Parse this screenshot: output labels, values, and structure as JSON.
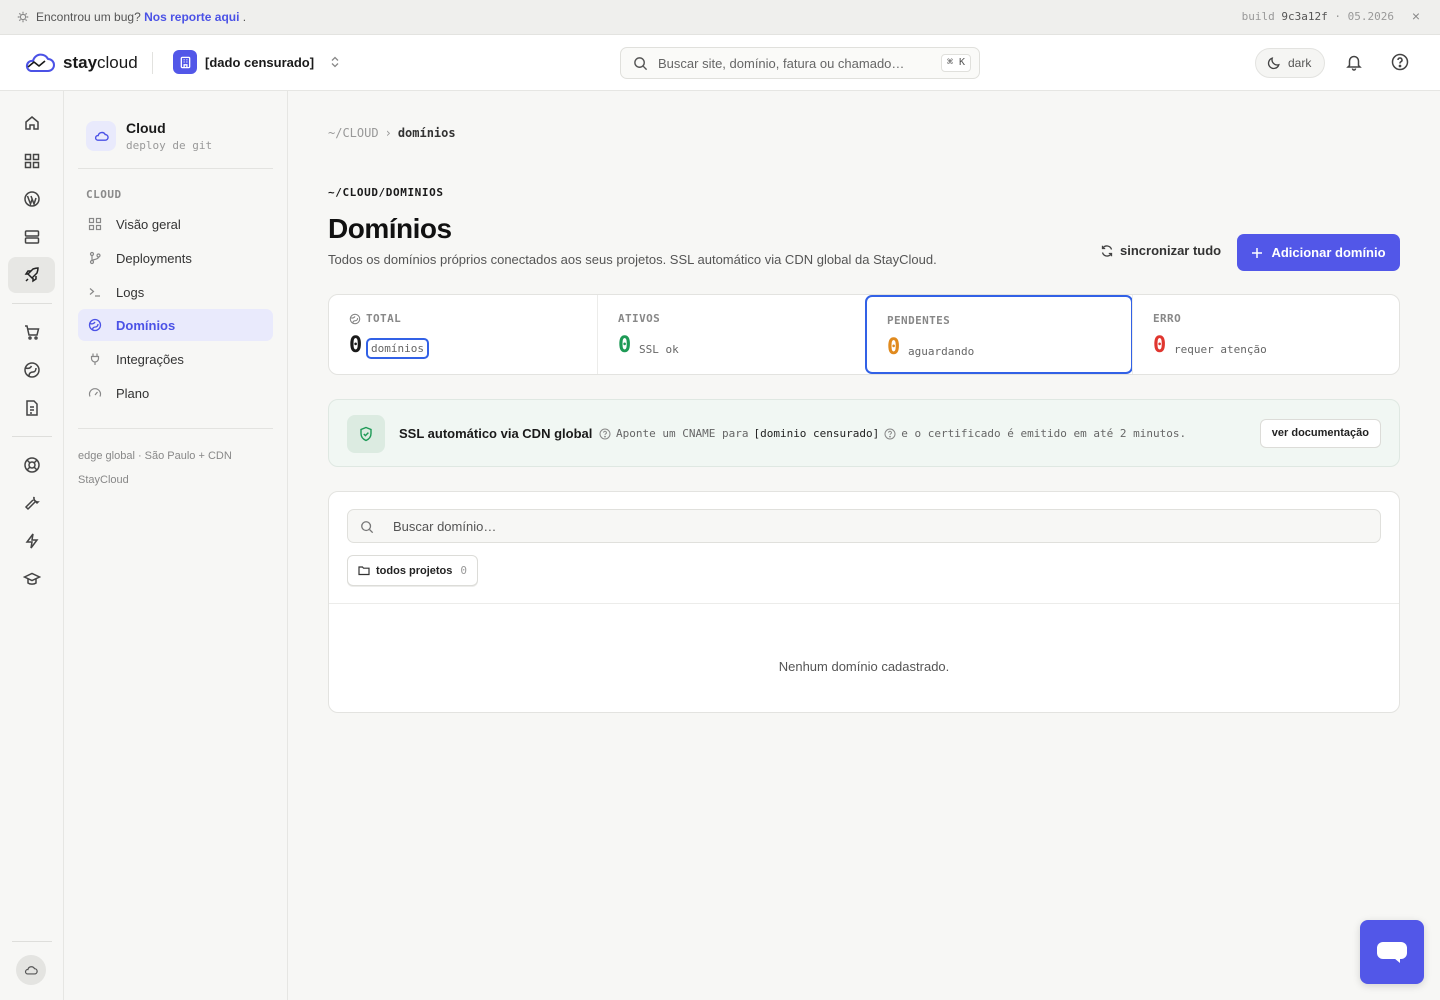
{
  "banner": {
    "message": "Encontrou um bug?",
    "link": "Nos reporte aqui",
    "period": ".",
    "build_label": "build",
    "build_hash": "9c3a12f",
    "build_sep": "·",
    "build_date": "05.2026",
    "close": "×"
  },
  "header": {
    "logo_bold": "stay",
    "logo_rest": "cloud",
    "org_name": "[dado censurado]",
    "search_placeholder": "Buscar site, domínio, fatura ou chamado…",
    "search_shortcut": "⌘ K",
    "theme_label": "dark"
  },
  "sidebar": {
    "title": "Cloud",
    "subtitle": "deploy de git",
    "section": "CLOUD",
    "items": [
      {
        "label": "Visão geral",
        "icon": "grid-icon"
      },
      {
        "label": "Deployments",
        "icon": "git-branch-icon"
      },
      {
        "label": "Logs",
        "icon": "terminal-icon"
      },
      {
        "label": "Domínios",
        "icon": "globe-icon",
        "active": true
      },
      {
        "label": "Integrações",
        "icon": "plug-icon"
      },
      {
        "label": "Plano",
        "icon": "gauge-icon"
      }
    ],
    "footer_1": "edge global · São Paulo + CDN",
    "footer_2": "StayCloud"
  },
  "main": {
    "breadcrumb_root": "~/CLOUD",
    "breadcrumb_sep": "›",
    "breadcrumb_current": "domínios",
    "path": "~/CLOUD/DOMINIOS",
    "title": "Domínios",
    "subtitle": "Todos os domínios próprios conectados aos seus projetos. SSL automático via CDN global da StayCloud.",
    "sync_label": "sincronizar tudo",
    "add_label": "Adicionar domínio",
    "stats": [
      {
        "label": "TOTAL",
        "value": "0",
        "unit": "domínios",
        "color": "#1a1a1a"
      },
      {
        "label": "ATIVOS",
        "value": "0",
        "unit": "SSL ok",
        "color": "#1e9a56"
      },
      {
        "label": "PENDENTES",
        "value": "0",
        "unit": "aguardando",
        "color": "#e08a1e"
      },
      {
        "label": "ERRO",
        "value": "0",
        "unit": "requer atenção",
        "color": "#e0362f"
      }
    ],
    "ssl": {
      "title": "SSL automático via CDN global",
      "desc_1": "Aponte um CNAME para",
      "desc_domain": "[dominio censurado]",
      "desc_2": "e o certificado é emitido em até 2 minutos.",
      "doc_button": "ver documentação"
    },
    "panel": {
      "search_placeholder": "Buscar domínio…",
      "chip_label": "todos projetos",
      "chip_count": "0",
      "empty": "Nenhum domínio cadastrado."
    }
  },
  "colors": {
    "accent": "#5257e8",
    "focus_ring": "#3261e6",
    "success": "#1e9a56",
    "warning": "#e08a1e",
    "danger": "#e0362f"
  }
}
